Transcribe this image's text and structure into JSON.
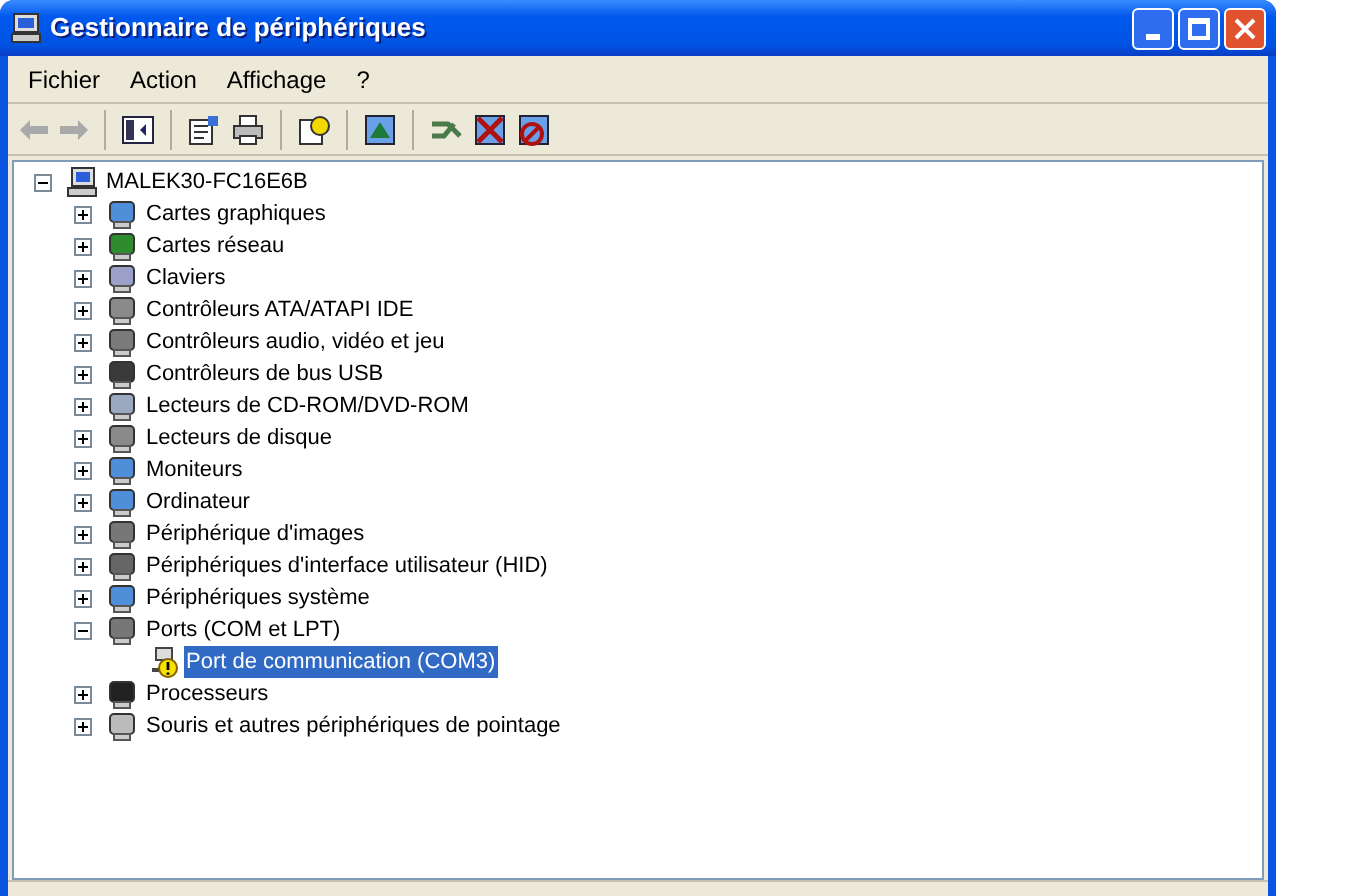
{
  "window": {
    "title": "Gestionnaire de périphériques"
  },
  "menu": [
    {
      "label": "Fichier"
    },
    {
      "label": "Action"
    },
    {
      "label": "Affichage"
    },
    {
      "label": "?"
    }
  ],
  "tree": {
    "label": "MALEK30-FC16E6B",
    "expanded": true,
    "selected": false,
    "children": [
      {
        "label": "Cartes graphiques",
        "expanded": false,
        "selected": false
      },
      {
        "label": "Cartes réseau",
        "expanded": false,
        "selected": false
      },
      {
        "label": "Claviers",
        "expanded": false,
        "selected": false
      },
      {
        "label": "Contrôleurs ATA/ATAPI IDE",
        "expanded": false,
        "selected": false
      },
      {
        "label": "Contrôleurs audio, vidéo et jeu",
        "expanded": false,
        "selected": false
      },
      {
        "label": "Contrôleurs de bus USB",
        "expanded": false,
        "selected": false
      },
      {
        "label": "Lecteurs de CD-ROM/DVD-ROM",
        "expanded": false,
        "selected": false
      },
      {
        "label": "Lecteurs de disque",
        "expanded": false,
        "selected": false
      },
      {
        "label": "Moniteurs",
        "expanded": false,
        "selected": false
      },
      {
        "label": "Ordinateur",
        "expanded": false,
        "selected": false
      },
      {
        "label": "Périphérique d'images",
        "expanded": false,
        "selected": false
      },
      {
        "label": "Périphériques d'interface utilisateur (HID)",
        "expanded": false,
        "selected": false
      },
      {
        "label": "Périphériques système",
        "expanded": false,
        "selected": false
      },
      {
        "label": "Ports (COM et LPT)",
        "expanded": true,
        "selected": false,
        "children": [
          {
            "label": "Port de communication (COM3)",
            "selected": true,
            "warning": true
          }
        ]
      },
      {
        "label": "Processeurs",
        "expanded": false,
        "selected": false
      },
      {
        "label": "Souris et autres périphériques de pointage",
        "expanded": false,
        "selected": false
      }
    ]
  }
}
